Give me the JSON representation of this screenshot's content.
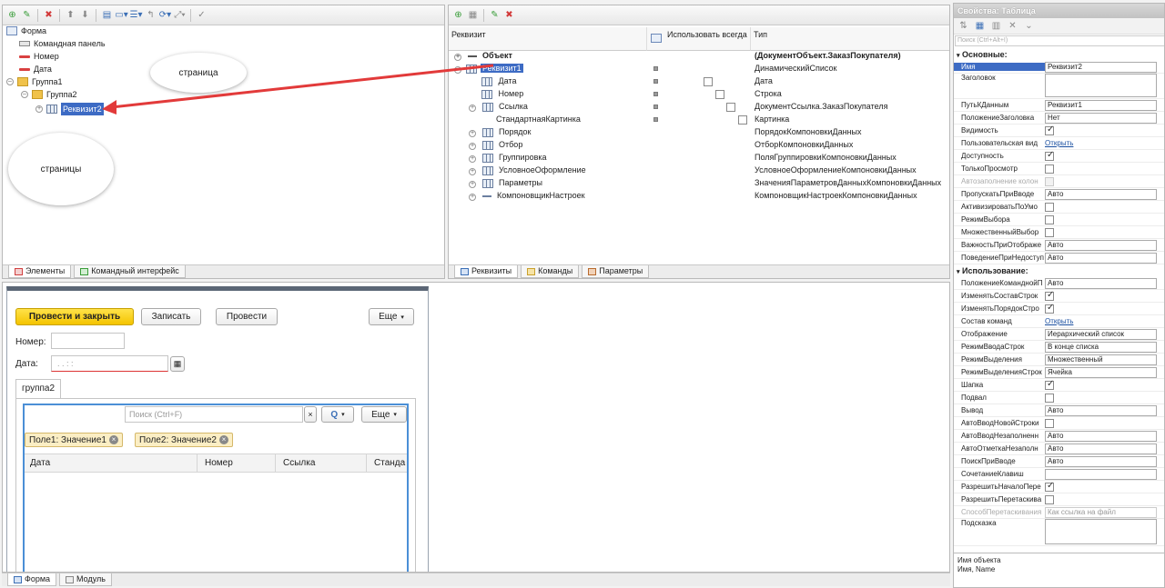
{
  "elements_panel": {
    "tree": [
      {
        "label": "Форма"
      },
      {
        "label": "Командная панель"
      },
      {
        "label": "Номер"
      },
      {
        "label": "Дата"
      },
      {
        "label": "Группа1"
      },
      {
        "label": "Группа2"
      },
      {
        "label": "Реквизит2"
      }
    ],
    "callout_top": "страница",
    "callout_bottom": "страницы",
    "tabs": [
      "Элементы",
      "Командный интерфейс"
    ]
  },
  "requisites_panel": {
    "columns": {
      "name": "Реквизит",
      "always": "Использовать всегда",
      "type": "Тип"
    },
    "rows": [
      {
        "name": "Объект",
        "type": "(ДокументОбъект.ЗаказПокупателя)"
      },
      {
        "name": "Реквизит1",
        "type": "ДинамическийСписок"
      },
      {
        "name": "Дата",
        "type": "Дата"
      },
      {
        "name": "Номер",
        "type": "Строка"
      },
      {
        "name": "Ссылка",
        "type": "ДокументСсылка.ЗаказПокупателя"
      },
      {
        "name": "СтандартнаяКартинка",
        "type": "Картинка"
      },
      {
        "name": "Порядок",
        "type": "ПорядокКомпоновкиДанных"
      },
      {
        "name": "Отбор",
        "type": "ОтборКомпоновкиДанных"
      },
      {
        "name": "Группировка",
        "type": "ПоляГруппировкиКомпоновкиДанных"
      },
      {
        "name": "УсловноеОформление",
        "type": "УсловноеОформлениеКомпоновкиДанных"
      },
      {
        "name": "Параметры",
        "type": "ЗначенияПараметровДанныхКомпоновкиДанных"
      },
      {
        "name": "КомпоновщикНастроек",
        "type": "КомпоновщикНастроекКомпоновкиДанных"
      }
    ],
    "tabs": [
      "Реквизиты",
      "Команды",
      "Параметры"
    ]
  },
  "preview": {
    "post_close": "Провести и закрыть",
    "write": "Записать",
    "post": "Провести",
    "more": "Еще",
    "number_label": "Номер:",
    "date_label": "Дата:",
    "date_mask": ". .   : :",
    "group_tab": "группа2",
    "search_placeholder": "Поиск (Ctrl+F)",
    "search_clear": "×",
    "search_btn": "Q",
    "more2": "Еще",
    "chip1": "Поле1: Значение1",
    "chip2": "Поле2: Значение2",
    "table_cols": [
      "Дата",
      "Номер",
      "Ссылка",
      "Станда"
    ]
  },
  "bottom_tabs": [
    "Форма",
    "Модуль"
  ],
  "properties": {
    "title": "Свойства: Таблица",
    "search_placeholder": "Поиск (Ctrl+Alt+I)",
    "section_main": "Основные:",
    "section_use": "Использование:",
    "main": [
      {
        "name": "Имя",
        "value": "Реквизит2",
        "kind": "input"
      },
      {
        "name": "Заголовок",
        "value": "",
        "kind": "area"
      },
      {
        "name": "ПутьКДанным",
        "value": "Реквизит1",
        "kind": "input"
      },
      {
        "name": "ПоложениеЗаголовка",
        "value": "Нет",
        "kind": "input"
      },
      {
        "name": "Видимость",
        "kind": "check",
        "checked": true
      },
      {
        "name": "Пользовательская вид",
        "value": "Открыть",
        "kind": "link"
      },
      {
        "name": "Доступность",
        "kind": "check",
        "checked": true
      },
      {
        "name": "ТолькоПросмотр",
        "kind": "check",
        "checked": false
      },
      {
        "name": "Автозаполнение колон",
        "kind": "check",
        "checked": false,
        "disabled": true
      },
      {
        "name": "ПропускатьПриВводе",
        "value": "Авто",
        "kind": "input"
      },
      {
        "name": "АктивизироватьПоУмо",
        "kind": "check",
        "checked": false
      },
      {
        "name": "РежимВыбора",
        "kind": "check",
        "checked": false
      },
      {
        "name": "МножественныйВыбор",
        "kind": "check",
        "checked": false
      },
      {
        "name": "ВажностьПриОтображе",
        "value": "Авто",
        "kind": "input"
      },
      {
        "name": "ПоведениеПриНедоступ",
        "value": "Авто",
        "kind": "input"
      }
    ],
    "use": [
      {
        "name": "ПоложениеКоманднойП",
        "value": "Авто",
        "kind": "input"
      },
      {
        "name": "ИзменятьСоставСтрок",
        "kind": "check",
        "checked": true
      },
      {
        "name": "ИзменятьПорядокСтро",
        "kind": "check",
        "checked": true
      },
      {
        "name": "Состав команд",
        "value": "Открыть",
        "kind": "link"
      },
      {
        "name": "Отображение",
        "value": "Иерархический список",
        "kind": "input"
      },
      {
        "name": "РежимВводаСтрок",
        "value": "В конце списка",
        "kind": "input"
      },
      {
        "name": "РежимВыделения",
        "value": "Множественный",
        "kind": "input"
      },
      {
        "name": "РежимВыделенияСтрок",
        "value": "Ячейка",
        "kind": "input"
      },
      {
        "name": "Шапка",
        "kind": "check",
        "checked": true
      },
      {
        "name": "Подвал",
        "kind": "check",
        "checked": false
      },
      {
        "name": "Вывод",
        "value": "Авто",
        "kind": "input"
      },
      {
        "name": "АвтоВводНовойСтроки",
        "kind": "check",
        "checked": false
      },
      {
        "name": "АвтоВводНезаполненн",
        "value": "Авто",
        "kind": "input"
      },
      {
        "name": "АвтоОтметкаНезаполн",
        "value": "Авто",
        "kind": "input"
      },
      {
        "name": "ПоискПриВводе",
        "value": "Авто",
        "kind": "input"
      },
      {
        "name": "СочетаниеКлавиш",
        "value": "",
        "kind": "input"
      },
      {
        "name": "РазрешитьНачалоПере",
        "kind": "check",
        "checked": true
      },
      {
        "name": "РазрешитьПеретаскива",
        "kind": "check",
        "checked": false
      },
      {
        "name": "СпособПеретаскивания",
        "value": "Как ссылка на файл",
        "kind": "input",
        "disabled": true
      },
      {
        "name": "Подсказка",
        "value": "",
        "kind": "area"
      }
    ],
    "footer_line1": "Имя объекта",
    "footer_line2": "Имя, Name"
  }
}
